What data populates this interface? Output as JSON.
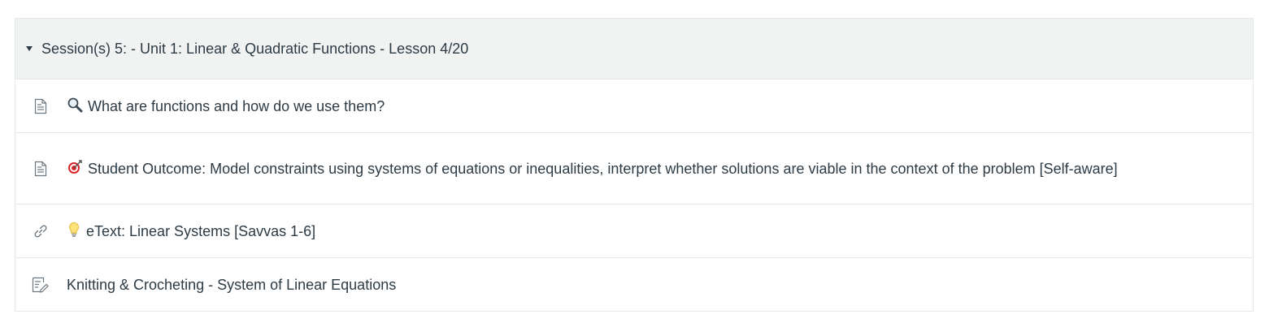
{
  "module": {
    "title": "Session(s) 5: - Unit 1: Linear & Quadratic Functions - Lesson 4/20",
    "toggle_icon": "caret-down-icon",
    "colors": {
      "header_bg": "#f1f3f3",
      "border": "#e6e9eb",
      "text": "#2d3b45",
      "icon": "#6b7780"
    },
    "items": [
      {
        "type_icon": "page-icon",
        "emoji_icon": "magnifying-glass-icon",
        "title": "What are functions and how do we use them?"
      },
      {
        "type_icon": "page-icon",
        "emoji_icon": "target-icon",
        "title": "Student Outcome: Model constraints using systems of equations or inequalities, interpret whether solutions are viable in the context of the problem [Self-aware]"
      },
      {
        "type_icon": "link-icon",
        "emoji_icon": "lightbulb-icon",
        "title": "eText: Linear Systems [Savvas 1-6]"
      },
      {
        "type_icon": "assignment-icon",
        "emoji_icon": "",
        "title": "Knitting & Crocheting - System of Linear Equations"
      }
    ]
  }
}
